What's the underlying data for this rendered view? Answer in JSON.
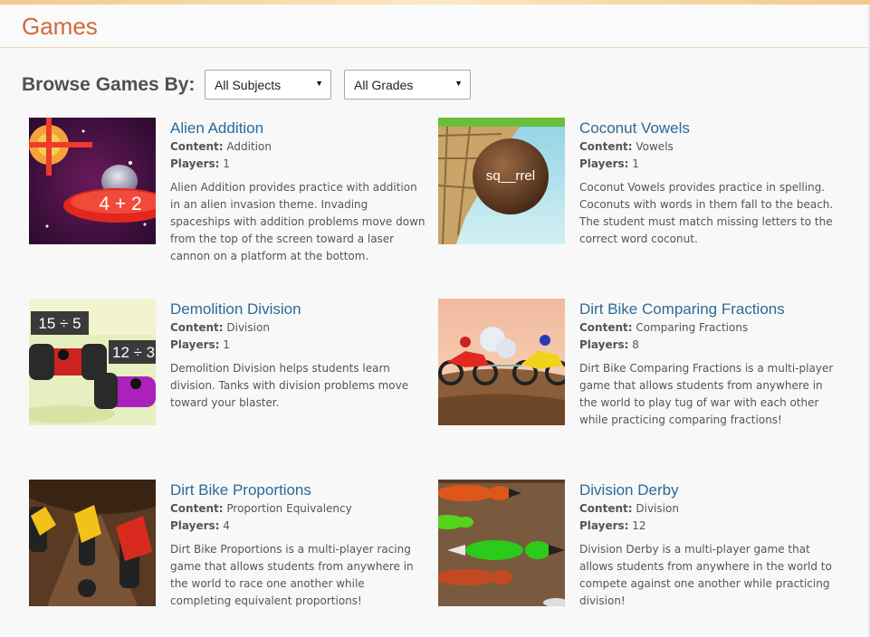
{
  "header": {
    "title": "Games"
  },
  "browse": {
    "label": "Browse Games By:",
    "subject_selected": "All Subjects",
    "grade_selected": "All Grades"
  },
  "labels": {
    "content": "Content:",
    "players": "Players:"
  },
  "games": [
    {
      "title": "Alien Addition",
      "content": "Addition",
      "players": "1",
      "description": "Alien Addition provides practice with addition in an alien invasion theme. Invading spaceships with addition problems move down from the top of the screen toward a laser cannon on a platform at the bottom.",
      "thumb_text": "4 + 2"
    },
    {
      "title": "Coconut Vowels",
      "content": "Vowels",
      "players": "1",
      "description": "Coconut Vowels provides practice in spelling. Coconuts with words in them fall to the beach. The student must match missing letters to the correct word coconut.",
      "thumb_text": "sq__rrel"
    },
    {
      "title": "Demolition Division",
      "content": "Division",
      "players": "1",
      "description": "Demolition Division helps students learn division. Tanks with division problems move toward your blaster.",
      "thumb_text": "15 ÷ 5",
      "thumb_text2": "12 ÷ 3"
    },
    {
      "title": "Dirt Bike Comparing Fractions",
      "content": "Comparing Fractions",
      "players": "8",
      "description": "Dirt Bike Comparing Fractions is a multi-player game that allows students from anywhere in the world to play tug of war with each other while practicing comparing fractions!"
    },
    {
      "title": "Dirt Bike Proportions",
      "content": "Proportion Equivalency",
      "players": "4",
      "description": "Dirt Bike Proportions is a multi-player racing game that allows students from anywhere in the world to race one another while completing equivalent proportions!"
    },
    {
      "title": "Division Derby",
      "content": "Division",
      "players": "12",
      "description": "Division Derby is a multi-player game that allows students from anywhere in the world to compete against one another while practicing division!"
    }
  ]
}
